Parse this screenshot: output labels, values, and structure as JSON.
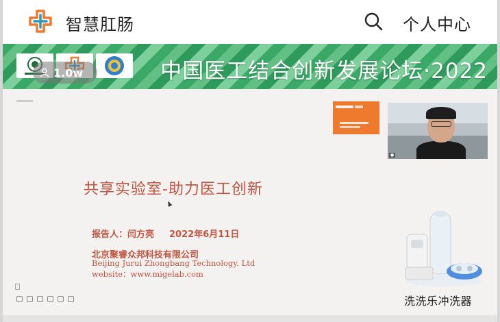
{
  "header": {
    "app_title": "智慧肛肠",
    "search_icon": "search-icon",
    "profile_label": "个人中心"
  },
  "banner": {
    "title": "中国医工结合创新发展论坛·2022",
    "viewer_count": "1.0w",
    "badges": [
      "institution-seal-badge",
      "app-logo-badge",
      "association-emblem-badge"
    ]
  },
  "slide": {
    "title": "共享实验室-助力医工创新",
    "reporter": "报告人：闫方亮",
    "date": "2022年6月11日",
    "company_cn": "北京聚睿众邦科技有限公司",
    "company_en": "Beijing Jurui Zhongbang Technology. Ltd",
    "website": "website：www.migelab.com"
  },
  "product": {
    "name": "洗洗乐冲洗器"
  },
  "colors": {
    "accent_orange": "#ef7a2e",
    "banner_green": "#3aa866",
    "slide_text": "#c4543f"
  }
}
